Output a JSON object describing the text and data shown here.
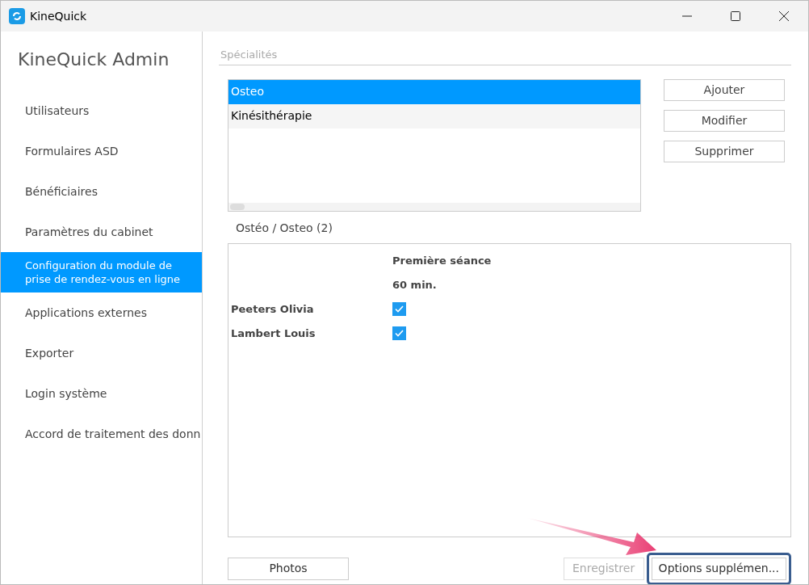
{
  "window": {
    "title": "KineQuick"
  },
  "sidebar": {
    "title": "KineQuick Admin",
    "items": [
      {
        "label": "Utilisateurs",
        "selected": false
      },
      {
        "label": "Formulaires ASD",
        "selected": false
      },
      {
        "label": "Bénéficiaires",
        "selected": false
      },
      {
        "label": "Paramètres du cabinet",
        "selected": false
      },
      {
        "label": "Configuration du module de prise de rendez-vous en ligne",
        "selected": true
      },
      {
        "label": "Applications externes",
        "selected": false
      },
      {
        "label": "Exporter",
        "selected": false
      },
      {
        "label": "Login système",
        "selected": false
      },
      {
        "label": "Accord de traitement des donn",
        "selected": false
      }
    ]
  },
  "specialties": {
    "heading": "Spécialités",
    "items": [
      {
        "label": "Osteo",
        "selected": true
      },
      {
        "label": "Kinésithérapie",
        "selected": false
      }
    ],
    "buttons": [
      "Ajouter",
      "Modifier",
      "Supprimer"
    ]
  },
  "grid": {
    "caption": "Ostéo / Osteo (2)",
    "column_header": "Première séance",
    "duration": "60 min.",
    "rows": [
      {
        "name": "Peeters Olivia",
        "checked": true
      },
      {
        "name": "Lambert Louis",
        "checked": true
      }
    ]
  },
  "footer": {
    "buttons": [
      {
        "label": "Photos",
        "disabled": false,
        "highlighted": false
      },
      {
        "label": "Enregistrer",
        "disabled": true,
        "highlighted": false
      },
      {
        "label": "Options supplémen...",
        "disabled": false,
        "highlighted": true
      }
    ]
  }
}
